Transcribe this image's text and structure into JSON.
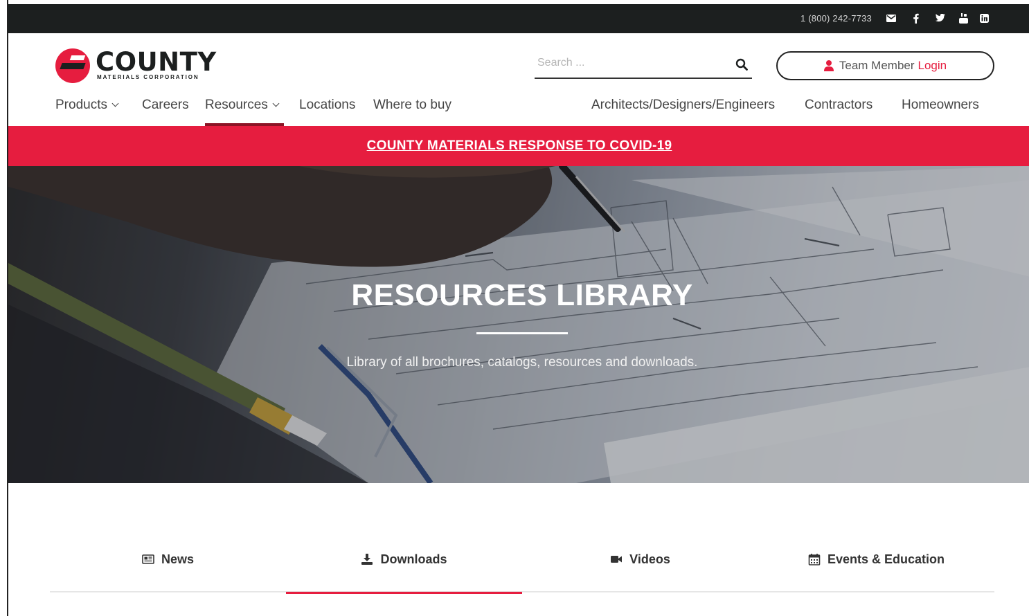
{
  "topbar": {
    "phone": "1 (800) 242-7733",
    "social_icons": [
      "mail-icon",
      "facebook-icon",
      "twitter-icon",
      "youtube-icon",
      "linkedin-icon"
    ]
  },
  "logo": {
    "name": "COUNTY",
    "subtitle": "MATERIALS CORPORATION"
  },
  "search": {
    "placeholder": "Search ..."
  },
  "login": {
    "label": "Team Member",
    "link": "Login"
  },
  "nav": {
    "left": [
      {
        "label": "Products",
        "has_dropdown": true
      },
      {
        "label": "Careers",
        "has_dropdown": false
      },
      {
        "label": "Resources",
        "has_dropdown": true,
        "active": true
      },
      {
        "label": "Locations",
        "has_dropdown": false
      },
      {
        "label": "Where to buy",
        "has_dropdown": false
      }
    ],
    "right": [
      {
        "label": "Architects/Designers/Engineers"
      },
      {
        "label": "Contractors"
      },
      {
        "label": "Homeowners"
      }
    ]
  },
  "banner": {
    "text": "COUNTY MATERIALS RESPONSE TO COVID-19"
  },
  "hero": {
    "title": "RESOURCES LIBRARY",
    "subtitle": "Library of all brochures, catalogs, resources and downloads."
  },
  "tabs": [
    {
      "label": "News",
      "icon": "newspaper-icon",
      "active": false
    },
    {
      "label": "Downloads",
      "icon": "download-icon",
      "active": true
    },
    {
      "label": "Videos",
      "icon": "video-camera-icon",
      "active": false
    },
    {
      "label": "Events & Education",
      "icon": "calendar-icon",
      "active": false
    }
  ],
  "colors": {
    "brand_red": "#e61d3f",
    "dark_bar": "#1c1f1f",
    "nav_active": "#8c1425"
  }
}
